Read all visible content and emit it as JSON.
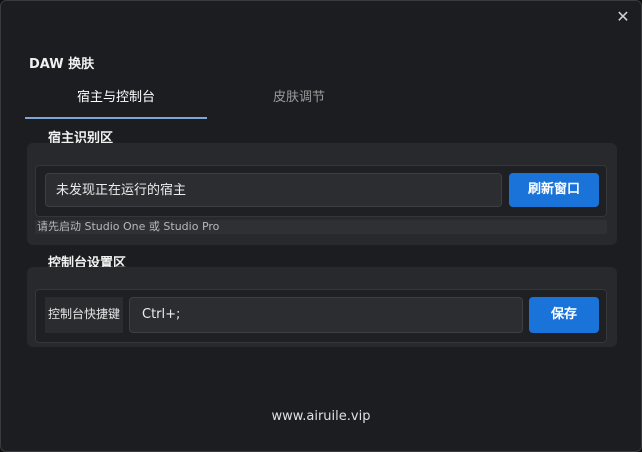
{
  "window": {
    "close_glyph": "✕"
  },
  "app": {
    "title": "DAW 换肤"
  },
  "tabs": [
    {
      "label": "宿主与控制台"
    },
    {
      "label": "皮肤调节"
    }
  ],
  "host_section": {
    "label": "宿主识别区",
    "status_value": "未发现正在运行的宿主",
    "refresh_label": "刷新窗口",
    "hint": "请先启动 Studio One 或 Studio Pro"
  },
  "console_section": {
    "label": "控制台设置区",
    "shortcut_label": "控制台快捷键",
    "shortcut_value": "Ctrl+;",
    "save_label": "保存"
  },
  "footer": {
    "text": "www.airuile.vip"
  },
  "colors": {
    "accent": "#1a73d9",
    "tab_underline": "#7fa6d6",
    "background": "#1c1d20"
  },
  "icons": {
    "close": "close-icon"
  }
}
